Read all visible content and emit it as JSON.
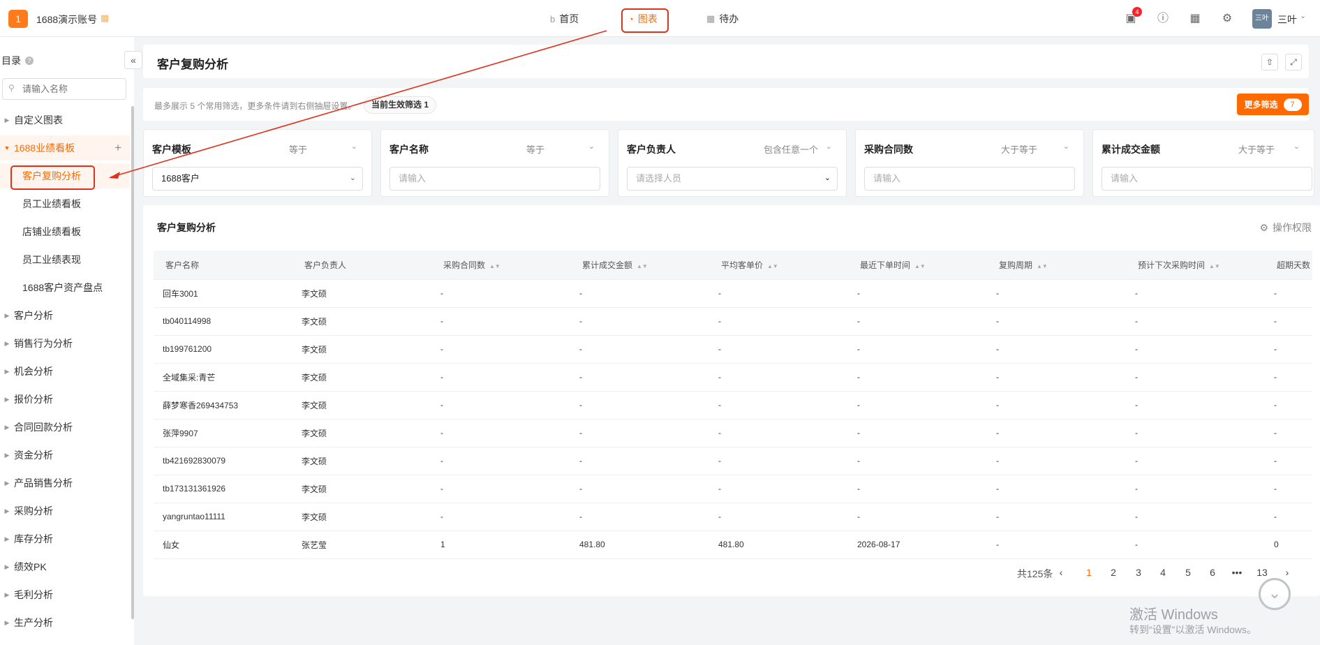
{
  "topbar": {
    "logo_text": "1",
    "account_name": "1688演示账号",
    "nav": [
      {
        "label": "首页"
      },
      {
        "label": "图表"
      },
      {
        "label": "待办"
      }
    ],
    "notification_count": "4",
    "avatar_text": "三叶",
    "username": "三叶"
  },
  "sidebar": {
    "title": "目录",
    "search_placeholder": "请输入名称",
    "items": [
      {
        "label": "自定义图表"
      },
      {
        "label": "1688业绩看板"
      },
      {
        "label": "客户分析"
      },
      {
        "label": "销售行为分析"
      },
      {
        "label": "机会分析"
      },
      {
        "label": "报价分析"
      },
      {
        "label": "合同回款分析"
      },
      {
        "label": "资金分析"
      },
      {
        "label": "产品销售分析"
      },
      {
        "label": "采购分析"
      },
      {
        "label": "库存分析"
      },
      {
        "label": "绩效PK"
      },
      {
        "label": "毛利分析"
      },
      {
        "label": "生产分析"
      }
    ],
    "subitems": [
      {
        "label": "客户复购分析"
      },
      {
        "label": "员工业绩看板"
      },
      {
        "label": "店铺业绩看板"
      },
      {
        "label": "员工业绩表现"
      },
      {
        "label": "1688客户资产盘点"
      }
    ]
  },
  "page": {
    "title": "客户复购分析",
    "filter_hint": "最多展示 5 个常用筛选，更多条件请到右侧抽屉设置。",
    "active_filter_chip": "当前生效筛选 1",
    "more_filter_label": "更多筛选",
    "more_filter_count": "7"
  },
  "filters": [
    {
      "label": "客户模板",
      "op": "等于",
      "value": "1688客户",
      "placeholder": ""
    },
    {
      "label": "客户名称",
      "op": "等于",
      "value": "",
      "placeholder": "请输入"
    },
    {
      "label": "客户负责人",
      "op": "包含任意一个",
      "value": "",
      "placeholder": "请选择人员"
    },
    {
      "label": "采购合同数",
      "op": "大于等于",
      "value": "",
      "placeholder": "请输入"
    },
    {
      "label": "累计成交金额",
      "op": "大于等于",
      "value": "",
      "placeholder": "请输入"
    }
  ],
  "table": {
    "title": "客户复购分析",
    "permission_label": "操作权限",
    "columns": [
      "客户名称",
      "客户负责人",
      "采购合同数",
      "累计成交金额",
      "平均客单价",
      "最近下单时间",
      "复购周期",
      "预计下次采购时间",
      "超期天数"
    ],
    "rows": [
      [
        "回车3001",
        "李文硕",
        "-",
        "-",
        "-",
        "-",
        "-",
        "-",
        "-"
      ],
      [
        "tb040114998",
        "李文硕",
        "-",
        "-",
        "-",
        "-",
        "-",
        "-",
        "-"
      ],
      [
        "tb199761200",
        "李文硕",
        "-",
        "-",
        "-",
        "-",
        "-",
        "-",
        "-"
      ],
      [
        "全域集采:青芒",
        "李文硕",
        "-",
        "-",
        "-",
        "-",
        "-",
        "-",
        "-"
      ],
      [
        "薛梦寒香269434753",
        "李文硕",
        "-",
        "-",
        "-",
        "-",
        "-",
        "-",
        "-"
      ],
      [
        "张萍9907",
        "李文硕",
        "-",
        "-",
        "-",
        "-",
        "-",
        "-",
        "-"
      ],
      [
        "tb421692830079",
        "李文硕",
        "-",
        "-",
        "-",
        "-",
        "-",
        "-",
        "-"
      ],
      [
        "tb173131361926",
        "李文硕",
        "-",
        "-",
        "-",
        "-",
        "-",
        "-",
        "-"
      ],
      [
        "yangruntao11111",
        "李文硕",
        "-",
        "-",
        "-",
        "-",
        "-",
        "-",
        "-"
      ],
      [
        "仙女",
        "张艺莹",
        "1",
        "481.80",
        "481.80",
        "2026-08-17",
        "-",
        "-",
        "0"
      ]
    ]
  },
  "pagination": {
    "total": "共125条",
    "pages": [
      "1",
      "2",
      "3",
      "4",
      "5",
      "6",
      "•••",
      "13"
    ]
  },
  "windows": {
    "line1": "激活 Windows",
    "line2": "转到“设置”以激活 Windows。"
  },
  "colors": {
    "accent": "#ff6a00",
    "annotation": "#e0311a"
  }
}
